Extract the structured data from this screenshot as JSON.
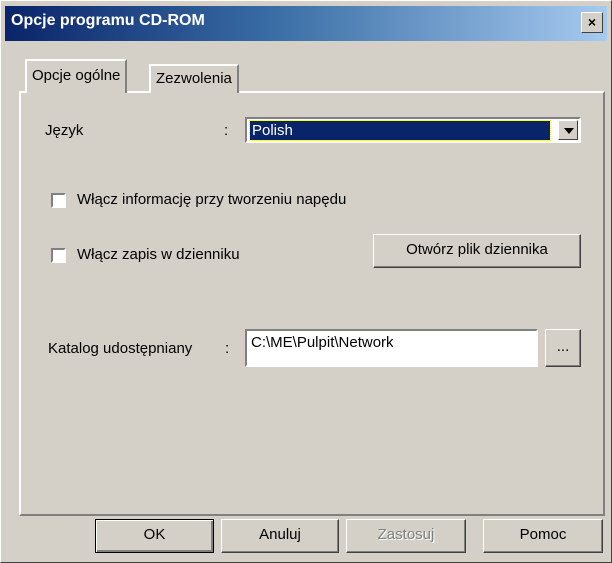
{
  "window": {
    "title": "Opcje programu CD-ROM",
    "close_label": "×"
  },
  "tabs": [
    {
      "label": "Opcje ogólne",
      "active": true
    },
    {
      "label": "Zezwolenia",
      "active": false
    }
  ],
  "general": {
    "language_label": "Język",
    "language_colon": ":",
    "language_value": "Polish",
    "checkbox_info_label": "Włącz informację przy tworzeniu napędu",
    "checkbox_info_checked": false,
    "checkbox_log_label": "Włącz zapis w dzienniku",
    "checkbox_log_checked": false,
    "open_log_button": "Otwórz plik dziennika",
    "shared_dir_label": "Katalog udostępniany",
    "shared_dir_colon": ":",
    "shared_dir_value": "C:\\ME\\Pulpit\\Network",
    "browse_button": "..."
  },
  "footer": {
    "ok_label": "OK",
    "cancel_label": "Anuluj",
    "apply_label": "Zastosuj",
    "help_label": "Pomoc"
  },
  "colors": {
    "titlebar_start": "#0a246a",
    "titlebar_end": "#a6caf0",
    "face": "#d4d0c8",
    "selection": "#0a246a"
  }
}
